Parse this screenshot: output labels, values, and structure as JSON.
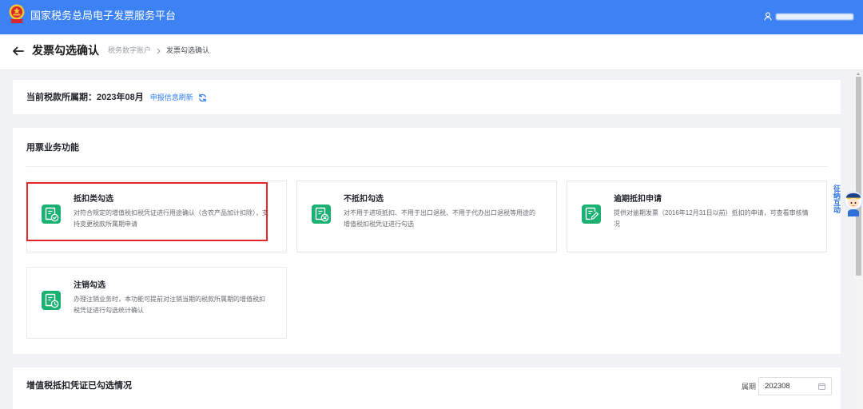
{
  "app": {
    "title": "国家税务总局电子发票服务平台",
    "logo_icon": "tax-emblem-icon",
    "user_icon": "user-icon"
  },
  "page_header": {
    "back_icon": "back-arrow-icon",
    "title": "发票勾选确认",
    "breadcrumb": [
      "税务数字账户",
      "发票勾选确认"
    ],
    "separator_icon": "chevron-right-icon"
  },
  "period_card": {
    "label": "当前税款所属期：",
    "value": "2023年08月",
    "refresh_link": "申报信息刷新",
    "refresh_icon": "refresh-icon"
  },
  "functions": {
    "title": "用票业务功能",
    "items": [
      {
        "title": "抵扣类勾选",
        "description": "对符合规定的增值税扣税凭证进行用途确认（含农产品加计扣除），支持变更税款所属期申请",
        "icon": "deduction-check-icon",
        "highlighted": true
      },
      {
        "title": "不抵扣勾选",
        "description": "对不用于进项抵扣、不用于出口退税、不用于代办出口退税等用途的增值税扣税凭证进行勾选",
        "icon": "non-deduction-icon",
        "highlighted": false
      },
      {
        "title": "逾期抵扣申请",
        "description": "提供对逾期发票（2016年12月31日以前）抵扣的申请，可查看审核情况",
        "icon": "overdue-apply-icon",
        "highlighted": false
      },
      {
        "title": "注销勾选",
        "description": "办理注销业务时，本功能可提前对注销当期的税款所属期的增值税扣税凭证进行勾选统计确认",
        "icon": "deregistration-icon",
        "highlighted": false
      }
    ]
  },
  "selected_summary": {
    "title": "增值税抵扣凭证已勾选情况",
    "period_label": "属期",
    "period_value": "202308",
    "calendar_icon": "calendar-icon"
  },
  "floating_widget": {
    "label": "征纳互动",
    "icon": "assistant-avatar-icon"
  },
  "colors": {
    "brand": "#3c82f5",
    "link": "#2e7cf6",
    "icon_green": "#1bb172",
    "highlight": "#e4262b",
    "page_bg": "#f0f2f5"
  }
}
